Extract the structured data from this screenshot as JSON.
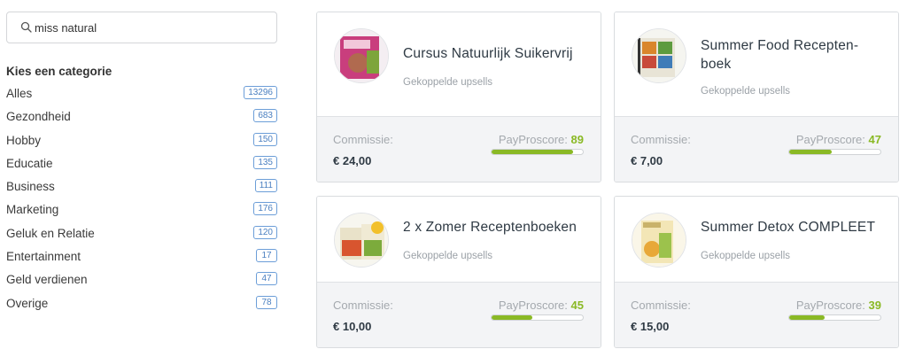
{
  "search": {
    "value": "miss natural"
  },
  "categories": {
    "title": "Kies een categorie",
    "items": [
      {
        "label": "Alles",
        "count": "13296"
      },
      {
        "label": "Gezondheid",
        "count": "683"
      },
      {
        "label": "Hobby",
        "count": "150"
      },
      {
        "label": "Educatie",
        "count": "135"
      },
      {
        "label": "Business",
        "count": "111"
      },
      {
        "label": "Marketing",
        "count": "176"
      },
      {
        "label": "Geluk en Relatie",
        "count": "120"
      },
      {
        "label": "Entertainment",
        "count": "17"
      },
      {
        "label": "Geld verdienen",
        "count": "47"
      },
      {
        "label": "Overige",
        "count": "78"
      }
    ]
  },
  "products": [
    {
      "title": "Cursus Natuurlijk Suikervrij",
      "upsells": "Gekoppelde upsells",
      "commission_label": "Commissie:",
      "commission": "€ 24,00",
      "score_label": "PayProscore:",
      "score": "89",
      "score_value": 89
    },
    {
      "title": "Summer Food Recepten-boek",
      "upsells": "Gekoppelde upsells",
      "commission_label": "Commissie:",
      "commission": "€ 7,00",
      "score_label": "PayProscore:",
      "score": "47",
      "score_value": 47
    },
    {
      "title": "2 x Zomer Receptenboeken",
      "upsells": "Gekoppelde upsells",
      "commission_label": "Commissie:",
      "commission": "€ 10,00",
      "score_label": "PayProscore:",
      "score": "45",
      "score_value": 45
    },
    {
      "title": "Summer Detox COMPLEET",
      "upsells": "Gekoppelde upsells",
      "commission_label": "Commissie:",
      "commission": "€ 15,00",
      "score_label": "PayProscore:",
      "score": "39",
      "score_value": 39
    }
  ],
  "colors": {
    "accent": "#8ab925",
    "badge": "#4a7fc0"
  }
}
